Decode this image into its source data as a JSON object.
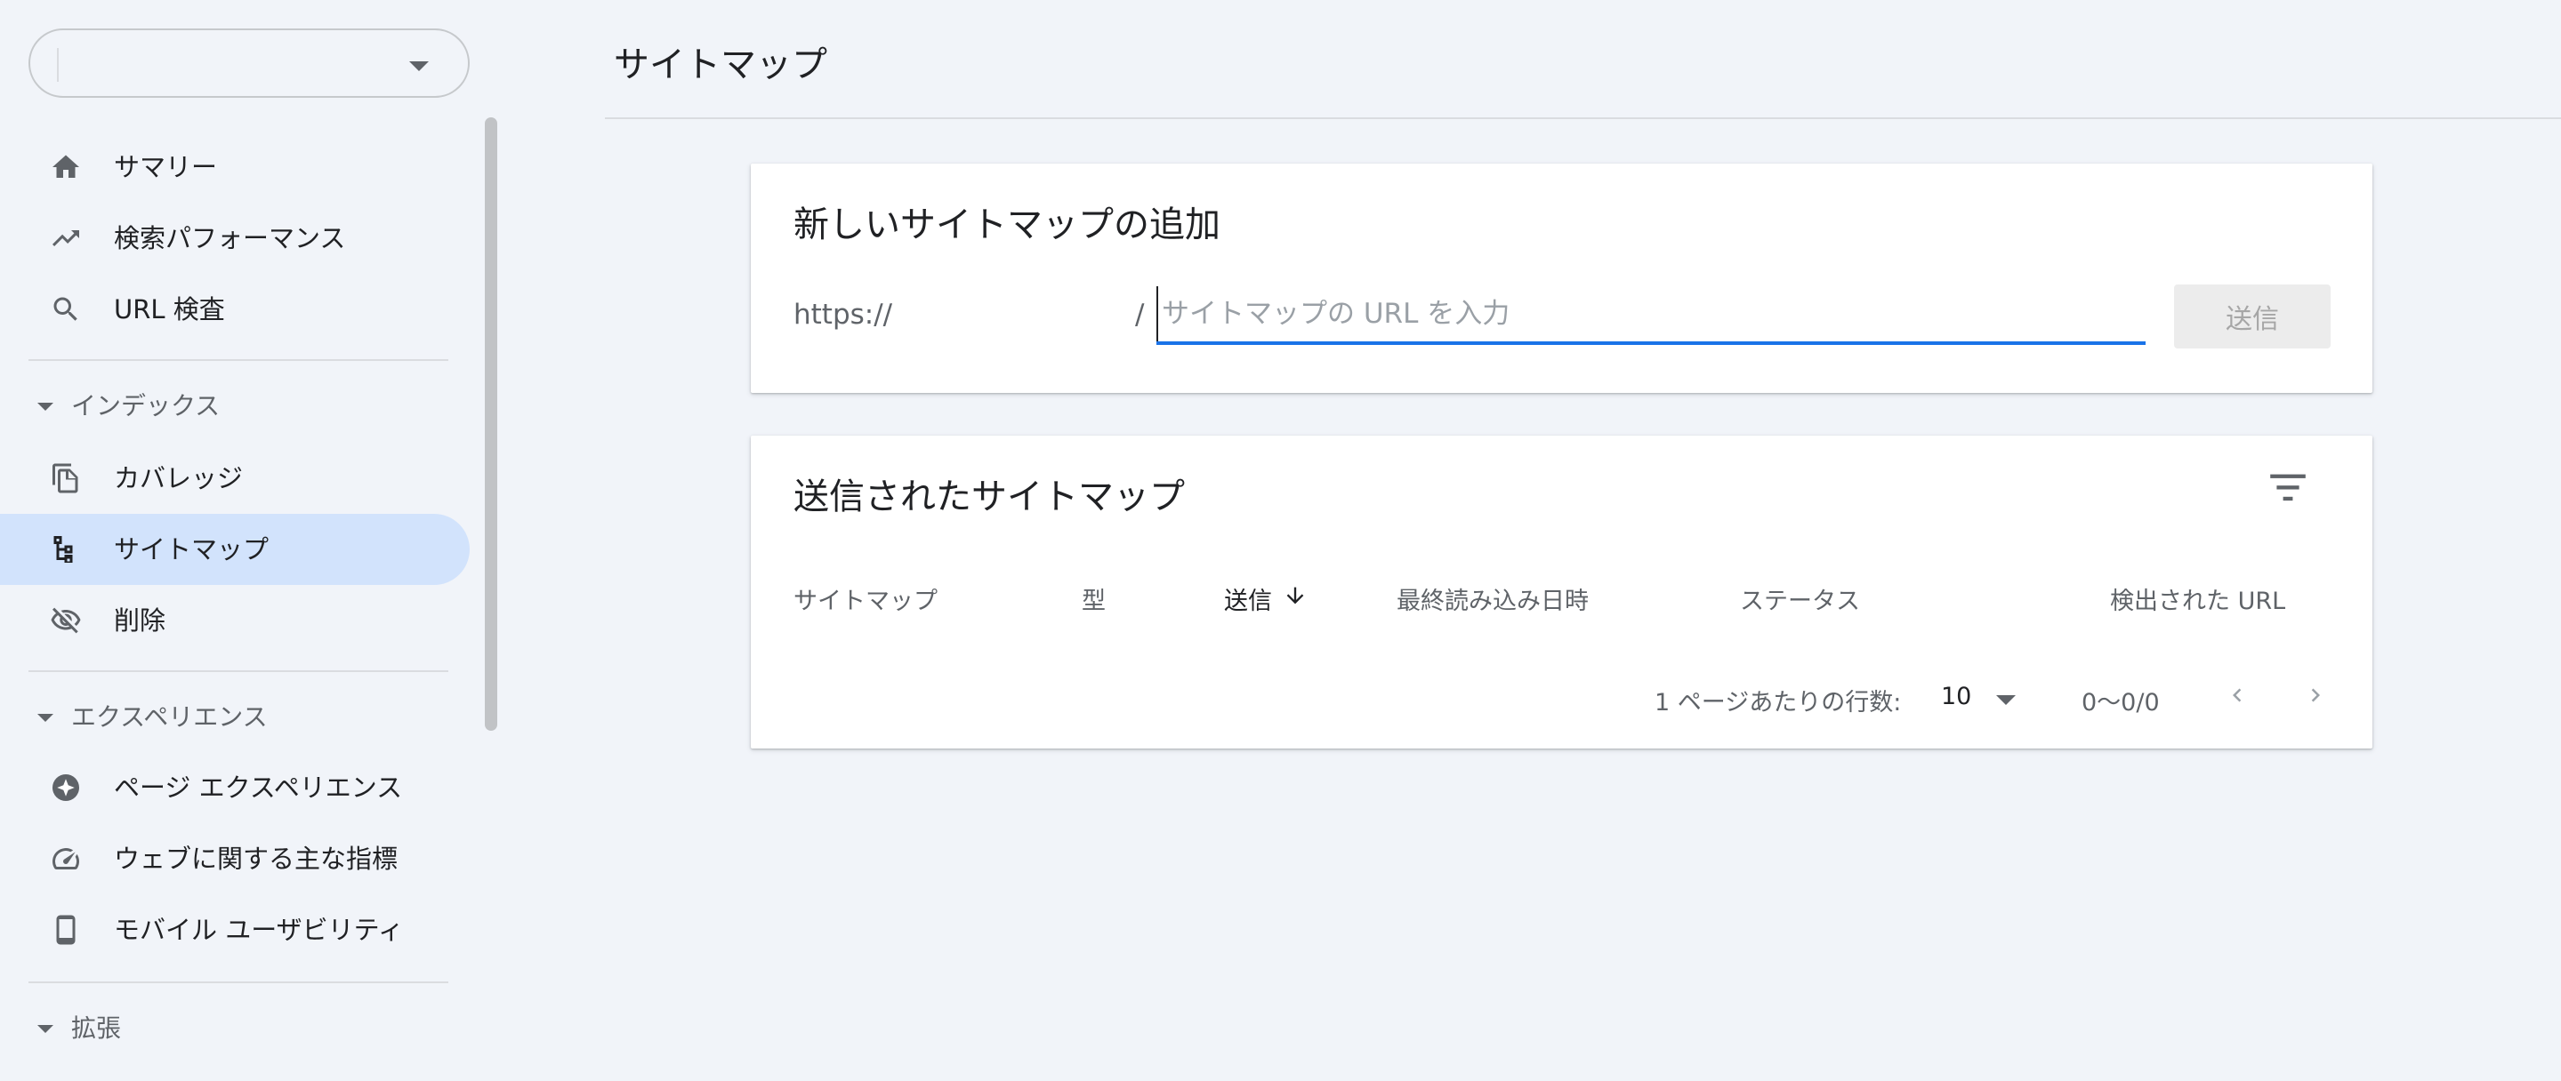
{
  "sidebar": {
    "property_value": "",
    "items": [
      {
        "label": "サマリー",
        "icon": "home-icon"
      },
      {
        "label": "検索パフォーマンス",
        "icon": "trending-up-icon"
      },
      {
        "label": "URL 検査",
        "icon": "search-icon"
      },
      {
        "label": "カバレッジ",
        "icon": "copy-pages-icon"
      },
      {
        "label": "サイトマップ",
        "icon": "sitemap-icon",
        "active": true
      },
      {
        "label": "削除",
        "icon": "visibility-off-icon"
      },
      {
        "label": "ページ エクスペリエンス",
        "icon": "page-experience-icon"
      },
      {
        "label": "ウェブに関する主な指標",
        "icon": "speed-gauge-icon"
      },
      {
        "label": "モバイル ユーザビリティ",
        "icon": "smartphone-icon"
      }
    ],
    "sections": {
      "index": "インデックス",
      "experience": "エクスペリエンス",
      "enhancements": "拡張"
    }
  },
  "header": {
    "title": "サイトマップ"
  },
  "add_card": {
    "title": "新しいサイトマップの追加",
    "url_prefix": "https://",
    "slash": "/",
    "input_value": "",
    "input_placeholder": "サイトマップの URL を入力",
    "submit_label": "送信"
  },
  "list_card": {
    "title": "送信されたサイトマップ",
    "columns": [
      "サイトマップ",
      "型",
      "送信",
      "最終読み込み日時",
      "ステータス",
      "検出された URL"
    ],
    "sorted_column": "送信",
    "pagination": {
      "rows_per_page_label": "1 ページあたりの行数:",
      "rows_per_page": "10",
      "range": "0〜0/0"
    }
  },
  "colors": {
    "accent": "#1a73e8",
    "active_nav_bg": "#d2e3fc",
    "page_bg": "#f1f4f9"
  }
}
